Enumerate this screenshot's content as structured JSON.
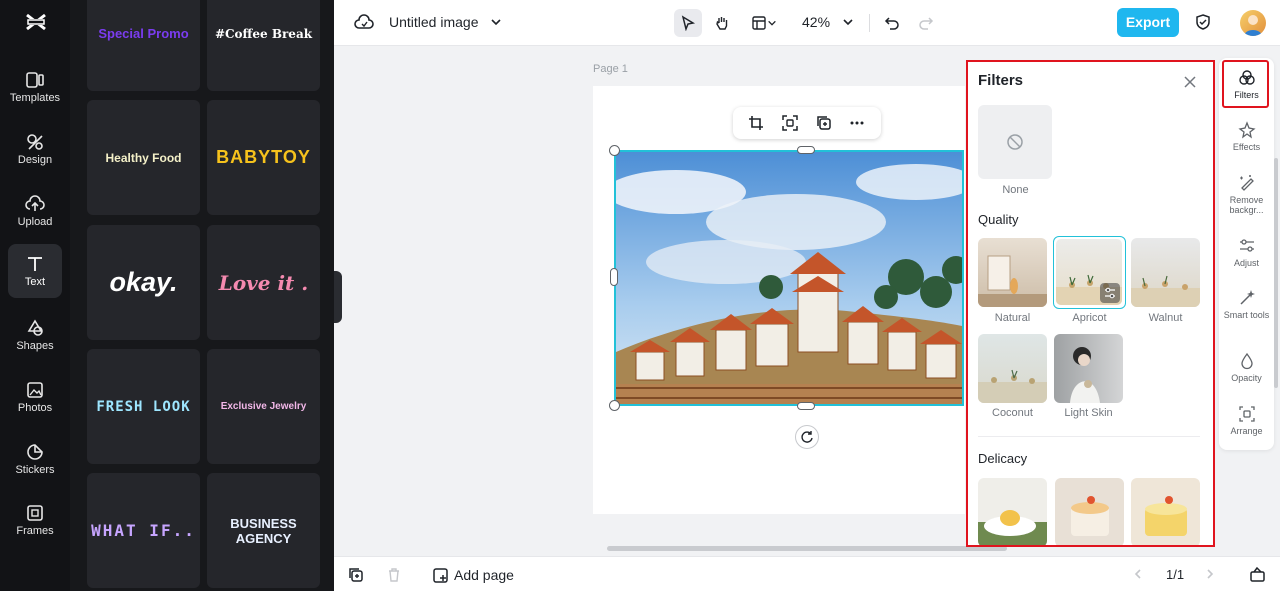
{
  "top_bar": {
    "doc_title": "Untitled image",
    "zoom": "42%",
    "export_label": "Export"
  },
  "left_rail": {
    "items": [
      {
        "label": "Templates",
        "icon": "templates-icon"
      },
      {
        "label": "Design",
        "icon": "design-icon"
      },
      {
        "label": "Upload",
        "icon": "upload-icon"
      },
      {
        "label": "Text",
        "icon": "text-icon",
        "active": true
      },
      {
        "label": "Shapes",
        "icon": "shapes-icon"
      },
      {
        "label": "Photos",
        "icon": "photos-icon"
      },
      {
        "label": "Stickers",
        "icon": "stickers-icon"
      },
      {
        "label": "Frames",
        "icon": "frames-icon"
      }
    ]
  },
  "text_templates": [
    {
      "label": "Special Promo",
      "color": "#7b3cf0"
    },
    {
      "label": "#Coffee Break",
      "color": "#ffffff"
    },
    {
      "label": "Healthy Food",
      "color": "#f4f0c8"
    },
    {
      "label": "BABYTOY",
      "color": "#f6c21c"
    },
    {
      "label": "okay.",
      "color": "#ffffff"
    },
    {
      "label": "Love it .",
      "color": "#f58ab0"
    },
    {
      "label": "FRESH LOOK",
      "color": "#9ee6ff"
    },
    {
      "label": "Exclusive Jewelry",
      "color": "#f2b7e8"
    },
    {
      "label": "WHAT IF..",
      "color": "#c7a5ff"
    },
    {
      "label": "BUSINESS AGENCY",
      "color": "#e8f0ff"
    }
  ],
  "canvas": {
    "page_label": "Page 1"
  },
  "bottom_bar": {
    "add_page_label": "Add page",
    "page_counter": "1/1"
  },
  "filters_panel": {
    "title": "Filters",
    "none_label": "None",
    "sections": [
      {
        "title": "Quality",
        "items": [
          "Natural",
          "Apricot",
          "Walnut",
          "Coconut",
          "Light Skin"
        ],
        "selected": "Apricot"
      },
      {
        "title": "Delicacy",
        "items": [
          "",
          "",
          ""
        ]
      }
    ]
  },
  "right_rail": {
    "items": [
      {
        "label": "Filters",
        "icon": "filters-icon",
        "active": true
      },
      {
        "label": "Effects",
        "icon": "effects-icon"
      },
      {
        "label": "Remove backgr...",
        "icon": "remove-background-icon"
      },
      {
        "label": "Adjust",
        "icon": "adjust-icon"
      },
      {
        "label": "Smart tools",
        "icon": "smart-tools-icon"
      },
      {
        "label": "Opacity",
        "icon": "opacity-icon"
      },
      {
        "label": "Arrange",
        "icon": "arrange-icon"
      }
    ]
  },
  "colors": {
    "accent": "#1fb7ef",
    "highlight_border": "#e0141e",
    "selection": "#22c1d8"
  }
}
